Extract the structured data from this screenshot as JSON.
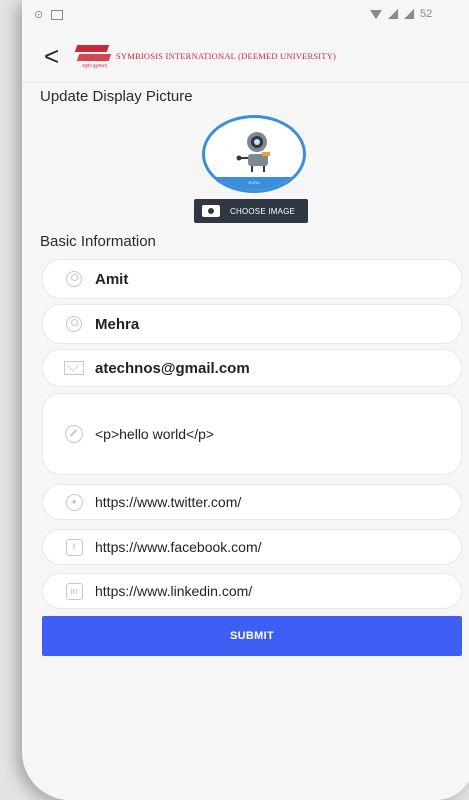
{
  "status_bar": {
    "left_text": "⊙",
    "right_text": "52"
  },
  "header": {
    "back_label": "<",
    "university_name": "SYMBIOSIS INTERNATIONAL (DEEMED UNIVERSITY)",
    "logo_tagline": "वसुधैव कुटुम्बकम्"
  },
  "display_picture": {
    "section_title": "Update Display Picture",
    "avatar_caption": "GURU",
    "choose_button_label": "CHOOSE IMAGE"
  },
  "basic_info": {
    "section_title": "Basic Information",
    "first_name": "Amit",
    "last_name": "Mehra",
    "email": "atechnos@gmail.com",
    "bio": "<p>hello world</p>",
    "twitter": "https://www.twitter.com/",
    "facebook": "https://www.facebook.com/",
    "linkedin": "https://www.linkedin.com/"
  },
  "submit_label": "SUBMIT",
  "colors": {
    "accent": "#3d5ef3",
    "brand_red": "#c9283a",
    "avatar_ring": "#3b8edb",
    "dark_button": "#2f3742"
  },
  "icons": [
    "back-arrow-icon",
    "user-icon",
    "mail-icon",
    "pencil-icon",
    "twitter-icon",
    "facebook-icon",
    "linkedin-icon",
    "camera-icon"
  ]
}
